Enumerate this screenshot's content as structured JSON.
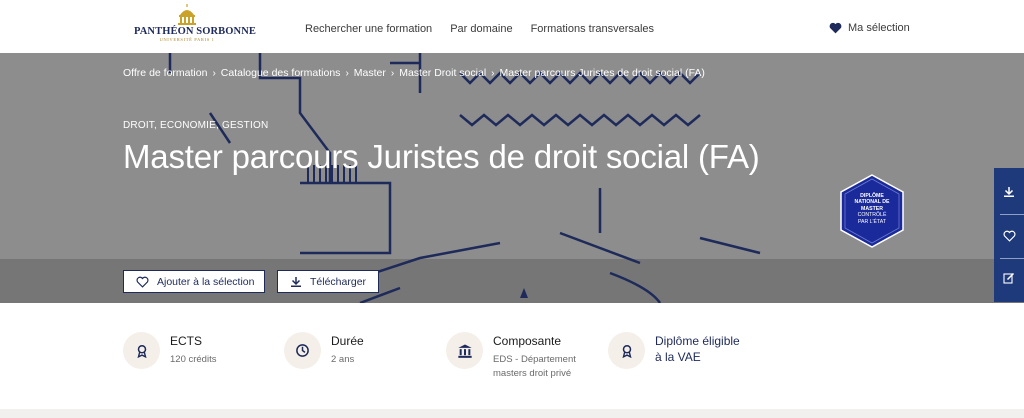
{
  "header": {
    "logo_main": "PANTHÉON SORBONNE",
    "logo_sub": "UNIVERSITÉ PARIS 1",
    "nav": [
      "Rechercher une formation",
      "Par domaine",
      "Formations transversales"
    ],
    "selection_label": "Ma sélection"
  },
  "breadcrumb": [
    "Offre de formation",
    "Catalogue des formations",
    "Master",
    "Master Droit social",
    "Master parcours Juristes de droit social (FA)"
  ],
  "hero": {
    "category": "DROIT, ECONOMIE, GESTION",
    "title": "Master parcours Juristes de droit social (FA)",
    "badge_lines": [
      "DIPLÔME",
      "NATIONAL DE",
      "MASTER",
      "CONTRÔLÉ",
      "PAR L'ÉTAT"
    ],
    "btn_add": "Ajouter à la sélection",
    "btn_download": "Télécharger"
  },
  "info": {
    "ects_label": "ECTS",
    "ects_value": "120 crédits",
    "duree_label": "Durée",
    "duree_value": "2 ans",
    "composante_label": "Composante",
    "composante_value_1": "EDS - Département",
    "composante_value_2": "masters droit privé",
    "vae_line_1": "Diplôme éligible",
    "vae_line_2": "à la VAE"
  },
  "colors": {
    "navy": "#1d2a5a",
    "rail_blue": "#1f3a7a",
    "hero_gray": "#8d8d8d",
    "icon_bg": "#f5efe9",
    "gold": "#c9a227"
  },
  "icons": {
    "rail": [
      "download-icon",
      "heart-icon",
      "edit-icon"
    ],
    "info": [
      "award-icon",
      "clock-icon",
      "institution-icon",
      "award-icon"
    ]
  }
}
